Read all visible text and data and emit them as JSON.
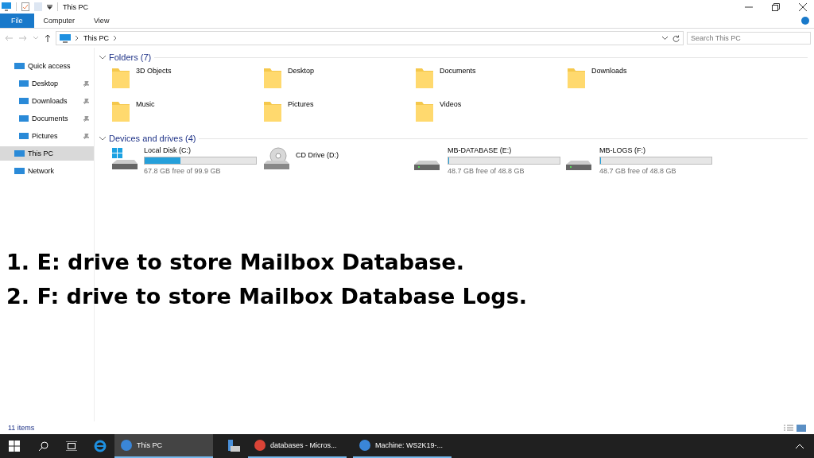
{
  "window": {
    "title": "This PC"
  },
  "ribbon_tabs": [
    {
      "label": "File",
      "selected": true
    },
    {
      "label": "Computer",
      "selected": false
    },
    {
      "label": "View",
      "selected": false
    }
  ],
  "address": {
    "crumbs": [
      "This PC"
    ]
  },
  "search": {
    "placeholder": "Search This PC"
  },
  "sidebar": {
    "items": [
      {
        "label": "Quick access",
        "selected": false,
        "children": [
          {
            "label": "Desktop",
            "pinned": true
          },
          {
            "label": "Downloads",
            "pinned": true
          },
          {
            "label": "Documents",
            "pinned": true
          },
          {
            "label": "Pictures",
            "pinned": true
          }
        ]
      },
      {
        "label": "This PC",
        "selected": true
      },
      {
        "label": "Network",
        "selected": false
      }
    ]
  },
  "groups": [
    {
      "title": "Folders (7)",
      "kind": "folders",
      "items": [
        {
          "label": "3D Objects"
        },
        {
          "label": "Desktop"
        },
        {
          "label": "Documents"
        },
        {
          "label": "Downloads"
        },
        {
          "label": "Music"
        },
        {
          "label": "Pictures"
        },
        {
          "label": "Videos"
        }
      ]
    },
    {
      "title": "Devices and drives (4)",
      "kind": "drives",
      "items": [
        {
          "label": "Local Disk (C:)",
          "kind": "system",
          "level": 0.32,
          "free": "67.8 GB free of 99.9 GB"
        },
        {
          "label": "CD Drive (D:)",
          "kind": "cd"
        },
        {
          "label": "MB-DATABASE (E:)",
          "kind": "disk",
          "level": 0.002,
          "free": "48.7 GB free of 48.8 GB"
        },
        {
          "label": "MB-LOGS (F:)",
          "kind": "disk",
          "level": 0.002,
          "free": "48.7 GB free of 48.8 GB"
        }
      ]
    }
  ],
  "captions": [
    "1. E: drive to store Mailbox Database.",
    "2. F: drive to store Mailbox Database Logs."
  ],
  "status_bar": {
    "count": "11 items"
  },
  "taskbar": {
    "apps": [
      {
        "label": "This PC",
        "selected": true
      },
      {
        "label": "databases - Micros...",
        "selected": false
      },
      {
        "label": "Machine: WS2K19-...",
        "selected": false
      }
    ]
  }
}
